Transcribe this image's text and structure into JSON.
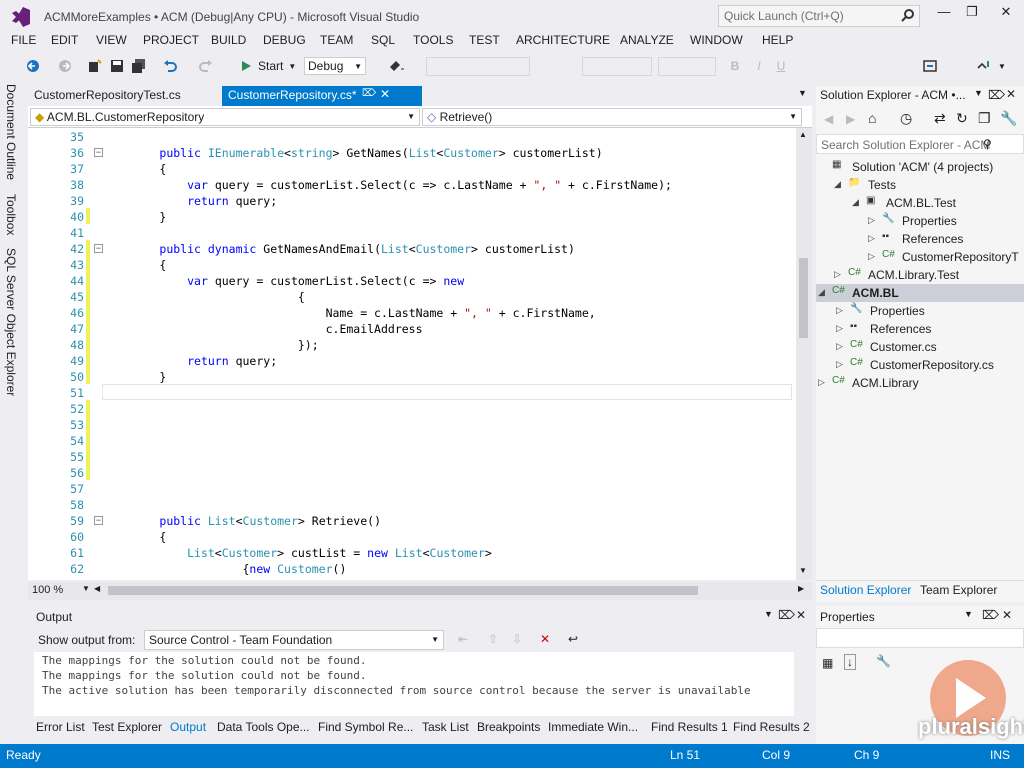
{
  "window": {
    "title": "ACMMoreExamples • ACM (Debug|Any CPU) - Microsoft Visual Studio",
    "quick_launch_placeholder": "Quick Launch (Ctrl+Q)"
  },
  "menu": [
    "FILE",
    "EDIT",
    "VIEW",
    "PROJECT",
    "BUILD",
    "DEBUG",
    "TEAM",
    "SQL",
    "TOOLS",
    "TEST",
    "ARCHITECTURE",
    "ANALYZE",
    "WINDOW",
    "HELP"
  ],
  "toolbar": {
    "start_label": "Start",
    "config": "Debug"
  },
  "left_strip": {
    "tabs": [
      "Document Outline",
      "Toolbox",
      "SQL Server Object Explorer"
    ]
  },
  "doc_tabs": [
    {
      "label": "CustomerRepositoryTest.cs"
    },
    {
      "label": "CustomerRepository.cs*",
      "active": true
    }
  ],
  "nav": {
    "class_selector": "ACM.BL.CustomerRepository",
    "member_selector": "Retrieve()"
  },
  "editor": {
    "lines": [
      {
        "n": "35",
        "t": ""
      },
      {
        "n": "36",
        "t": "        public IEnumerable<string> GetNames(List<Customer> customerList)"
      },
      {
        "n": "37",
        "t": "        {"
      },
      {
        "n": "38",
        "t": "            var query = customerList.Select(c => c.LastName + \", \" + c.FirstName);"
      },
      {
        "n": "39",
        "t": "            return query;"
      },
      {
        "n": "40",
        "t": "        }"
      },
      {
        "n": "41",
        "t": ""
      },
      {
        "n": "42",
        "t": "        public dynamic GetNamesAndEmail(List<Customer> customerList)"
      },
      {
        "n": "43",
        "t": "        {"
      },
      {
        "n": "44",
        "t": "            var query = customerList.Select(c => new"
      },
      {
        "n": "45",
        "t": "                            {"
      },
      {
        "n": "46",
        "t": "                                Name = c.LastName + \", \" + c.FirstName,"
      },
      {
        "n": "47",
        "t": "                                c.EmailAddress"
      },
      {
        "n": "48",
        "t": "                            });"
      },
      {
        "n": "49",
        "t": "            return query;"
      },
      {
        "n": "50",
        "t": "        }"
      },
      {
        "n": "51",
        "t": ""
      },
      {
        "n": "52",
        "t": ""
      },
      {
        "n": "53",
        "t": ""
      },
      {
        "n": "54",
        "t": ""
      },
      {
        "n": "55",
        "t": ""
      },
      {
        "n": "56",
        "t": ""
      },
      {
        "n": "57",
        "t": ""
      },
      {
        "n": "58",
        "t": ""
      },
      {
        "n": "59",
        "t": "        public List<Customer> Retrieve()"
      },
      {
        "n": "60",
        "t": "        {"
      },
      {
        "n": "61",
        "t": "            List<Customer> custList = new List<Customer>"
      },
      {
        "n": "62",
        "t": "                    {new Customer()"
      }
    ],
    "zoom": "100 %"
  },
  "solution_explorer": {
    "title": "Solution Explorer - ACM •...",
    "search_placeholder": "Search Solution Explorer - ACM",
    "items": [
      {
        "label": "Solution 'ACM' (4 projects)",
        "icon": "solution-icon"
      },
      {
        "label": "Tests",
        "icon": "folder-icon"
      },
      {
        "label": "ACM.BL.Test",
        "icon": "test-project-icon"
      },
      {
        "label": "Properties",
        "icon": "wrench-icon"
      },
      {
        "label": "References",
        "icon": "references-icon"
      },
      {
        "label": "CustomerRepositoryT",
        "icon": "csharp-file-icon"
      },
      {
        "label": "ACM.Library.Test",
        "icon": "csharp-project-icon"
      },
      {
        "label": "ACM.BL",
        "icon": "csharp-project-icon",
        "selected": true
      },
      {
        "label": "Properties",
        "icon": "wrench-icon"
      },
      {
        "label": "References",
        "icon": "references-icon"
      },
      {
        "label": "Customer.cs",
        "icon": "csharp-file-icon"
      },
      {
        "label": "CustomerRepository.cs",
        "icon": "csharp-file-icon"
      },
      {
        "label": "ACM.Library",
        "icon": "csharp-project-icon"
      }
    ],
    "tabs": [
      "Solution Explorer",
      "Team Explorer"
    ]
  },
  "properties": {
    "title": "Properties"
  },
  "output": {
    "title": "Output",
    "show_from_label": "Show output from:",
    "source": "Source Control - Team Foundation",
    "lines": [
      "The mappings for the solution could not be found.",
      "The mappings for the solution could not be found.",
      "The active solution has been temporarily disconnected from source control because the server is unavailable"
    ]
  },
  "bottom_tabs": [
    "Error List",
    "Test Explorer",
    "Output",
    "Data Tools Ope...",
    "Find Symbol Re...",
    "Task List",
    "Breakpoints",
    "Immediate Win...",
    "Find Results 1",
    "Find Results 2"
  ],
  "status": {
    "ready": "Ready",
    "ln": "Ln 51",
    "col": "Col 9",
    "ch": "Ch 9",
    "ins": "INS"
  },
  "watermark": {
    "brand": "pluralsight"
  },
  "colors": {
    "accent": "#007acc",
    "keyword": "#0000ff",
    "type": "#2b91af",
    "string": "#a31515"
  }
}
